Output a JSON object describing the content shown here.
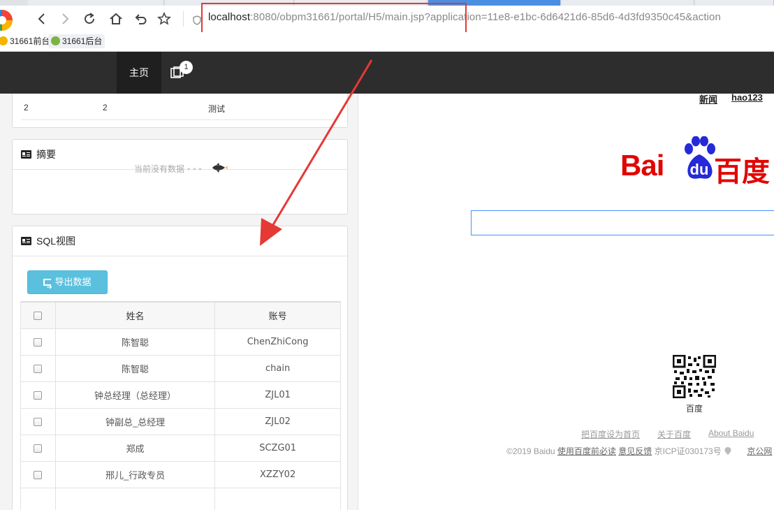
{
  "browser": {
    "url_host": "localhost",
    "url_rest": ":8080/obpm31661/portal/H5/main.jsp?application=11e8-e1bc-6d6421d6-85d6-4d3fd9350c45&action",
    "bookmarks": [
      {
        "label": "31661前台"
      },
      {
        "label": "31661后台"
      }
    ]
  },
  "app": {
    "nav_home": "主页",
    "message_badge": "1"
  },
  "top_row": {
    "col1": "2",
    "col2": "2",
    "col3": "测试"
  },
  "summary_panel": {
    "title": "摘要",
    "empty_text": "当前没有数据"
  },
  "sql_panel": {
    "title": "SQL视图",
    "export_label": "导出数据",
    "columns": [
      "姓名",
      "账号"
    ],
    "rows": [
      {
        "name": "陈智聪",
        "account": "ChenZhiCong"
      },
      {
        "name": "陈智聪",
        "account": "chain"
      },
      {
        "name": "钟总经理（总经理）",
        "account": "ZJL01"
      },
      {
        "name": "钟副总_总经理",
        "account": "ZJL02"
      },
      {
        "name": "郑成",
        "account": "SCZG01"
      },
      {
        "name": "邢儿_行政专员",
        "account": "XZZY02"
      }
    ]
  },
  "baidu": {
    "top_links": [
      "新闻",
      "hao123"
    ],
    "logo_latin": "Bai",
    "logo_du": "du",
    "logo_cn": "百度",
    "qr_label": "百度",
    "footer_links": [
      "把百度设为首页",
      "关于百度",
      "About  Baidu"
    ],
    "copyright": "©2019 Baidu",
    "notice": "使用百度前必读",
    "feedback": "意见反馈",
    "icp": "京ICP证030173号",
    "police": "京公网"
  },
  "colors": {
    "annotation_red": "#e53935",
    "export_button": "#5bc0de",
    "header_bg": "#2d2d2d",
    "baidu_red": "#e10602",
    "baidu_blue": "#2529d8"
  }
}
